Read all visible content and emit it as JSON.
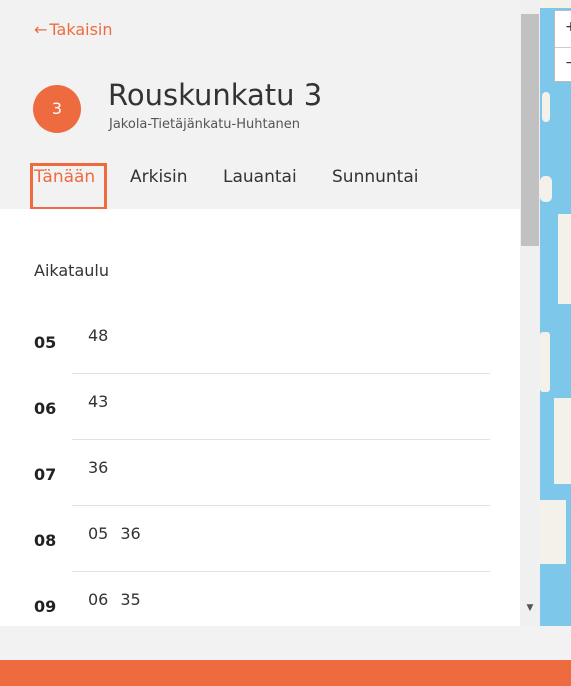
{
  "header": {
    "back_label": "Takaisin",
    "back_arrow": "←",
    "route_number": "3",
    "stop_name": "Rouskunkatu 3",
    "route_name": "Jakola-Tietäjänkatu-Huhtanen"
  },
  "tabs": [
    {
      "label": "Tänään",
      "active": true
    },
    {
      "label": "Arkisin",
      "active": false
    },
    {
      "label": "Lauantai",
      "active": false
    },
    {
      "label": "Sunnuntai",
      "active": false
    }
  ],
  "schedule": {
    "title": "Aikataulu",
    "rows": [
      {
        "hour": "05",
        "minutes": [
          "48"
        ]
      },
      {
        "hour": "06",
        "minutes": [
          "43"
        ]
      },
      {
        "hour": "07",
        "minutes": [
          "36"
        ]
      },
      {
        "hour": "08",
        "minutes": [
          "05",
          "36"
        ]
      },
      {
        "hour": "09",
        "minutes": [
          "06",
          "35"
        ]
      }
    ]
  },
  "map": {
    "zoom_in_label": "+",
    "zoom_out_label": "−"
  },
  "colors": {
    "accent": "#ee6b40",
    "water": "#7cc7ea",
    "land": "#f4f1ea"
  }
}
